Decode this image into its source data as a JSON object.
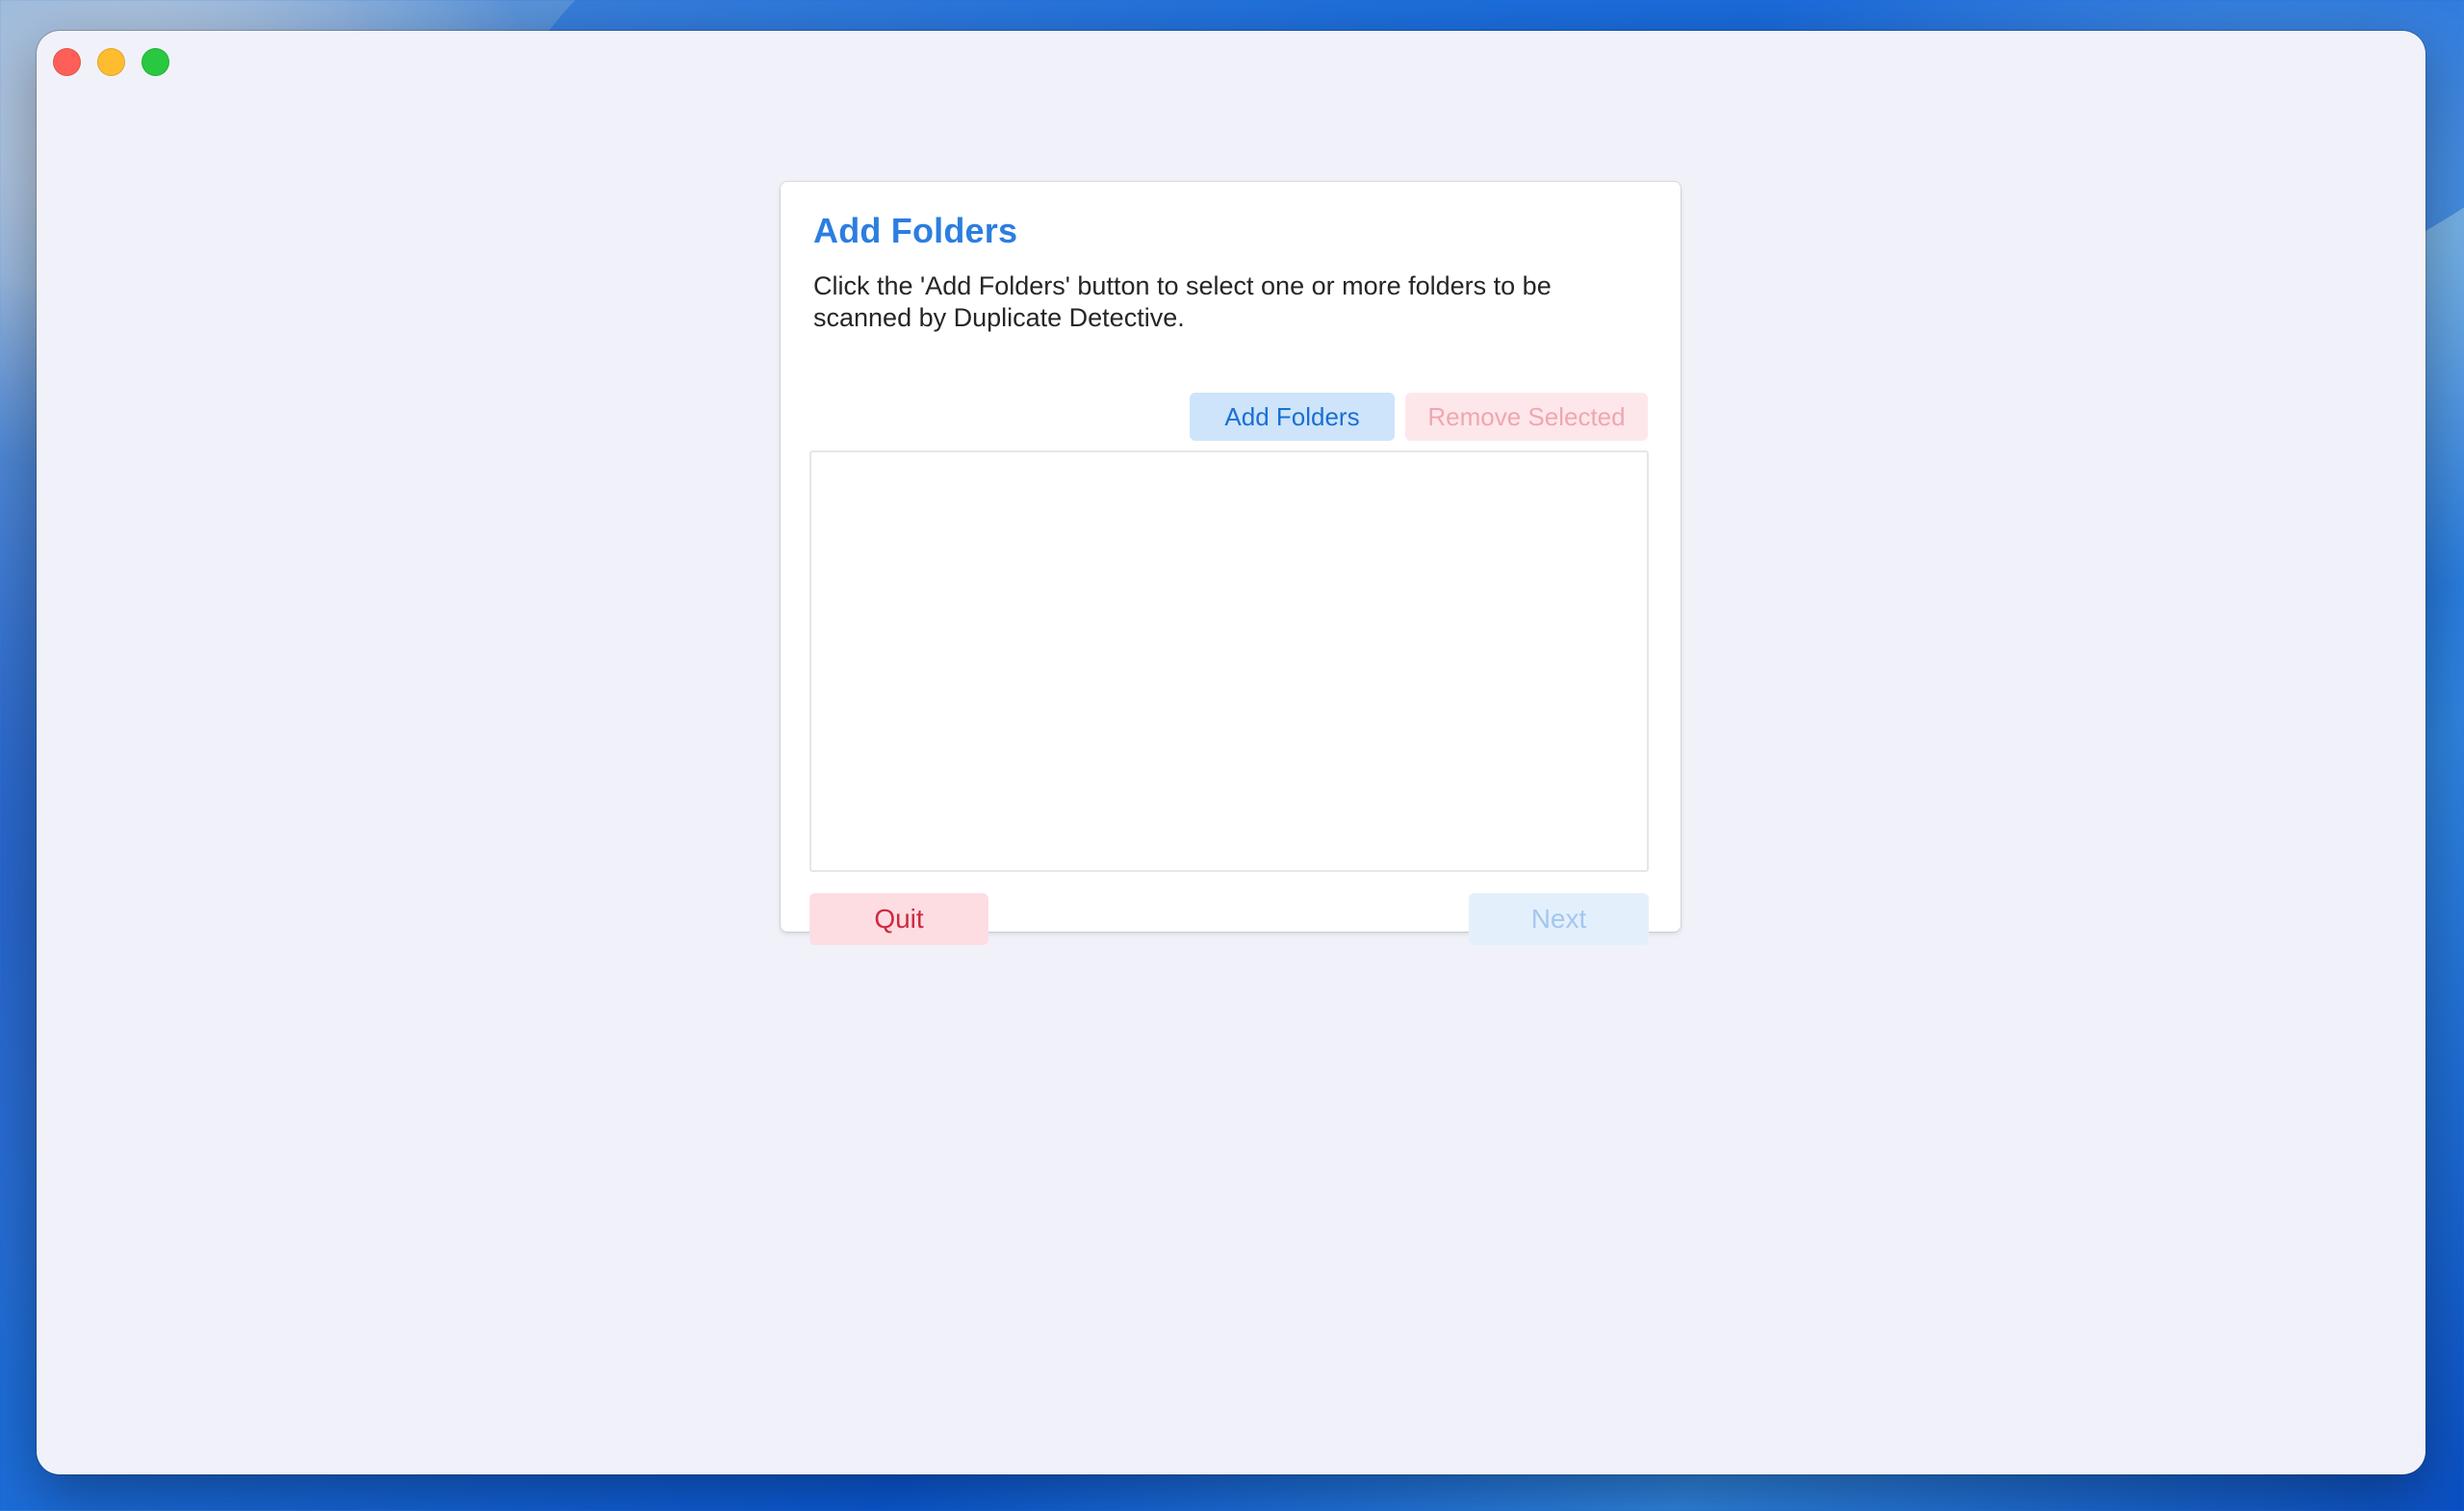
{
  "window": {
    "controls": {
      "close_icon": "close-icon",
      "minimize_icon": "minimize-icon",
      "zoom_icon": "zoom-icon"
    }
  },
  "panel": {
    "title": "Add Folders",
    "description": "Click the 'Add Folders' button to select one or more folders to be scanned by Duplicate Detective.",
    "add_folders_label": "Add Folders",
    "remove_selected_label": "Remove Selected",
    "folders": [],
    "quit_label": "Quit",
    "next_label": "Next"
  },
  "colors": {
    "accent": "#2c7ee0",
    "danger": "#d0283f",
    "window_bg": "#f1f2f9"
  }
}
